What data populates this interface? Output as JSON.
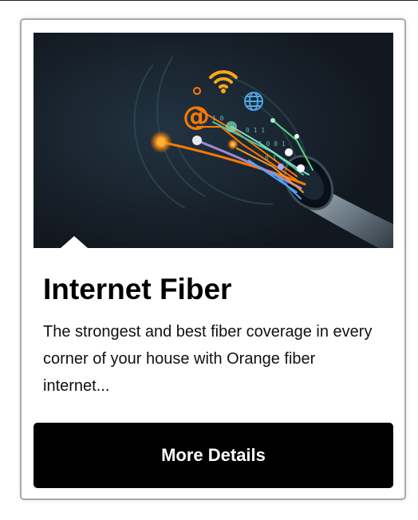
{
  "card": {
    "image_alt": "Fiber optic cable illustration",
    "title": "Internet Fiber",
    "description": "The strongest and best fiber coverage in every corner of your house with Orange fiber internet...",
    "button_label": "More Details"
  },
  "colors": {
    "brand_orange": "#ff7900",
    "button_bg": "#000000",
    "hero_bg": "#141b23"
  },
  "icons": [
    "wifi-icon",
    "at-sign-icon",
    "globe-icon",
    "fiber-cable-icon"
  ]
}
